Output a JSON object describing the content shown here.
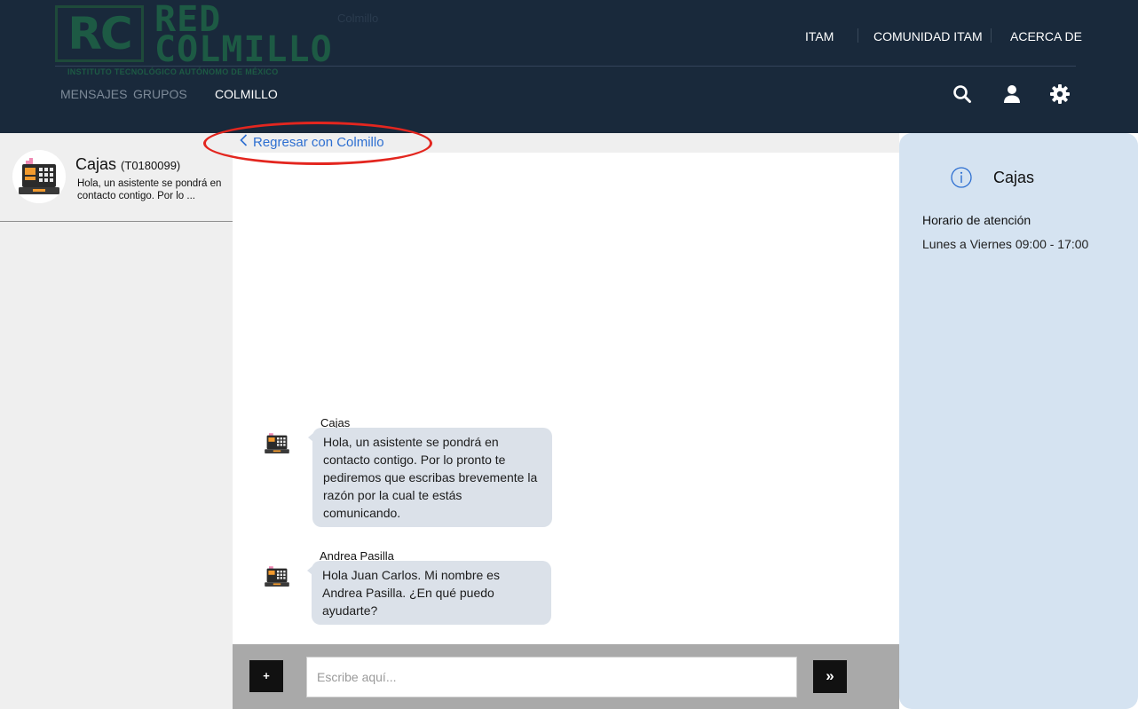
{
  "colors": {
    "header_bg": "#19293b",
    "sidebar_bg": "#efefef",
    "info_panel_bg": "#d5e3f1",
    "bubble_bg": "#dbe1e9",
    "link": "#2d6fd1",
    "highlight": "#e3261f",
    "logo_green": "#1d5a44"
  },
  "header": {
    "logo": {
      "rc": "RC",
      "red": "RED",
      "colmillo": "COLMILLO",
      "institute": "INSTITUTO TECNOLÓGICO AUTÓNOMO DE MÉXICO"
    },
    "ghost_text": "Colmillo",
    "top_nav": [
      "ITAM",
      "COMUNIDAD ITAM",
      "ACERCA DE"
    ],
    "sub_nav": [
      "MENSAJES",
      "GRUPOS",
      "COLMILLO"
    ],
    "active_sub_nav": "COLMILLO",
    "icons": [
      "search-icon",
      "user-icon",
      "settings-icon"
    ]
  },
  "sidebar": {
    "conversations": [
      {
        "name": "Cajas",
        "id": "(T0180099)",
        "preview": "Hola, un asistente se pondrá en contacto contigo. Por lo ...",
        "icon": "cash-register-icon"
      }
    ]
  },
  "chat": {
    "back_link": "Regresar con Colmillo",
    "messages": [
      {
        "sender": "Cajas",
        "text": "Hola, un asistente se pondrá en contacto contigo. Por lo pronto te pediremos que escribas brevemente la razón por la cual te estás comunicando."
      },
      {
        "sender": "Andrea Pasilla",
        "text": "Hola Juan Carlos. Mi nombre es Andrea Pasilla. ¿En qué puedo ayudarte?"
      }
    ],
    "input": {
      "placeholder": "Escribe aquí...",
      "value": "",
      "attach_label": "+",
      "send_label": "»"
    }
  },
  "info_panel": {
    "title": "Cajas",
    "hours_label": "Horario de atención",
    "hours": "Lunes a Viernes 09:00 - 17:00"
  }
}
